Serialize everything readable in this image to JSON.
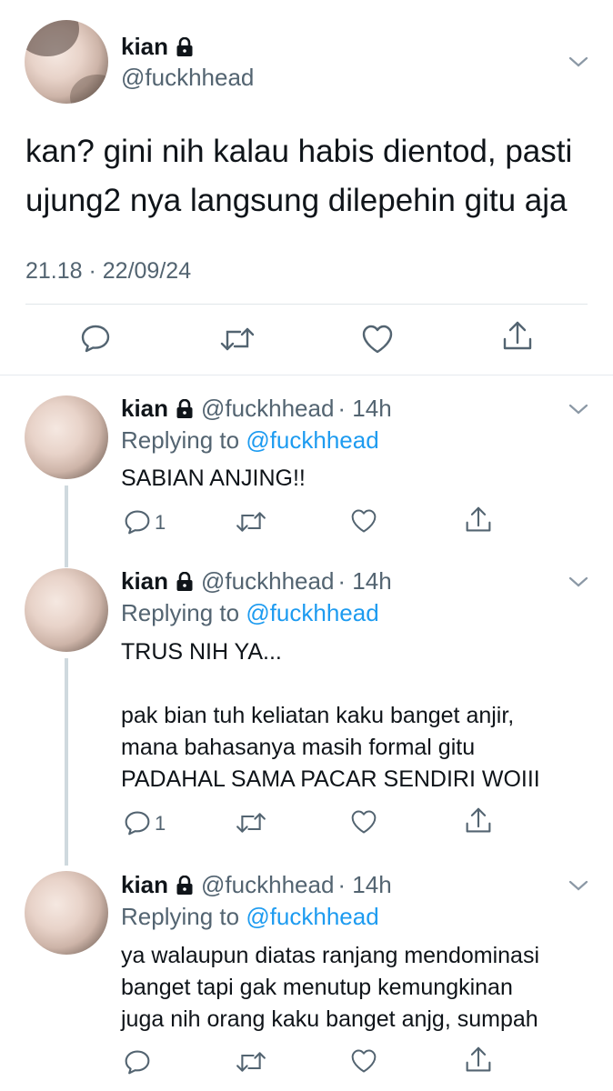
{
  "main": {
    "name": "kian",
    "handle": "@fuckhhead",
    "text_line1": "kan? gini nih kalau habis dientod, pasti",
    "text_line2": "ujung2 nya langsung dilepehin gitu aja",
    "timestamp": "21.18 · 22/09/24"
  },
  "replies": [
    {
      "name": "kian",
      "handle": "@fuckhhead",
      "time": "· 14h",
      "replying_prefix": "Replying to ",
      "replying_to": "@fuckhhead",
      "lines": [
        "SABIAN ANJING!!"
      ],
      "reply_count": "1"
    },
    {
      "name": "kian",
      "handle": "@fuckhhead",
      "time": "· 14h",
      "replying_prefix": "Replying to ",
      "replying_to": "@fuckhhead",
      "lines": [
        "TRUS NIH YA...",
        "",
        "pak bian tuh keliatan kaku banget anjir,",
        "mana bahasanya masih formal gitu",
        "PADAHAL SAMA PACAR SENDIRI WOIII"
      ],
      "reply_count": "1"
    },
    {
      "name": "kian",
      "handle": "@fuckhhead",
      "time": "· 14h",
      "replying_prefix": "Replying to ",
      "replying_to": "@fuckhhead",
      "lines": [
        "ya walaupun diatas ranjang mendominasi",
        "banget tapi gak menutup kemungkinan",
        "juga nih orang kaku banget anjg, sumpah"
      ],
      "reply_count": ""
    }
  ],
  "icons": {
    "reply": "reply-icon",
    "retweet": "retweet-icon",
    "like": "like-icon",
    "share": "share-icon",
    "lock": "lock-icon",
    "chevron": "chevron-down-icon"
  },
  "colors": {
    "link": "#1d9bf0",
    "secondary_text": "#536471",
    "text": "#0f1419"
  }
}
